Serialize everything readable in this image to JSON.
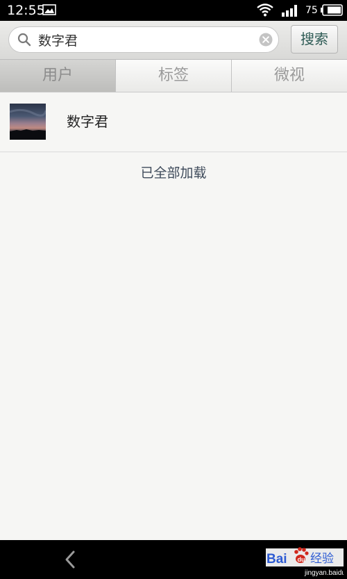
{
  "status_bar": {
    "time": "12:55",
    "battery_level": "75",
    "icons": [
      "gallery-icon",
      "wifi-icon",
      "signal-icon",
      "battery-icon"
    ]
  },
  "search": {
    "query": "数字君",
    "button_label": "搜索",
    "icons": [
      "search-icon",
      "clear-icon"
    ]
  },
  "tabs": [
    {
      "label": "用户",
      "active": true
    },
    {
      "label": "标签",
      "active": false
    },
    {
      "label": "微视",
      "active": false
    }
  ],
  "results": [
    {
      "name": "数字君",
      "avatar": "dusk-sky-thumbnail"
    }
  ],
  "load_status": "已全部加载",
  "navigation": {
    "icons": [
      "back-icon"
    ]
  },
  "watermark": {
    "brand": "Baidu经验",
    "url": "jingyan.baidu.com"
  },
  "colors": {
    "status_bar_bg": "#000000",
    "content_bg": "#f6f6f4",
    "search_button_text": "#2d5a54",
    "tab_text": "#9a9a9a",
    "watermark_blue": "#2d5bd3",
    "watermark_red": "#d0281c"
  }
}
